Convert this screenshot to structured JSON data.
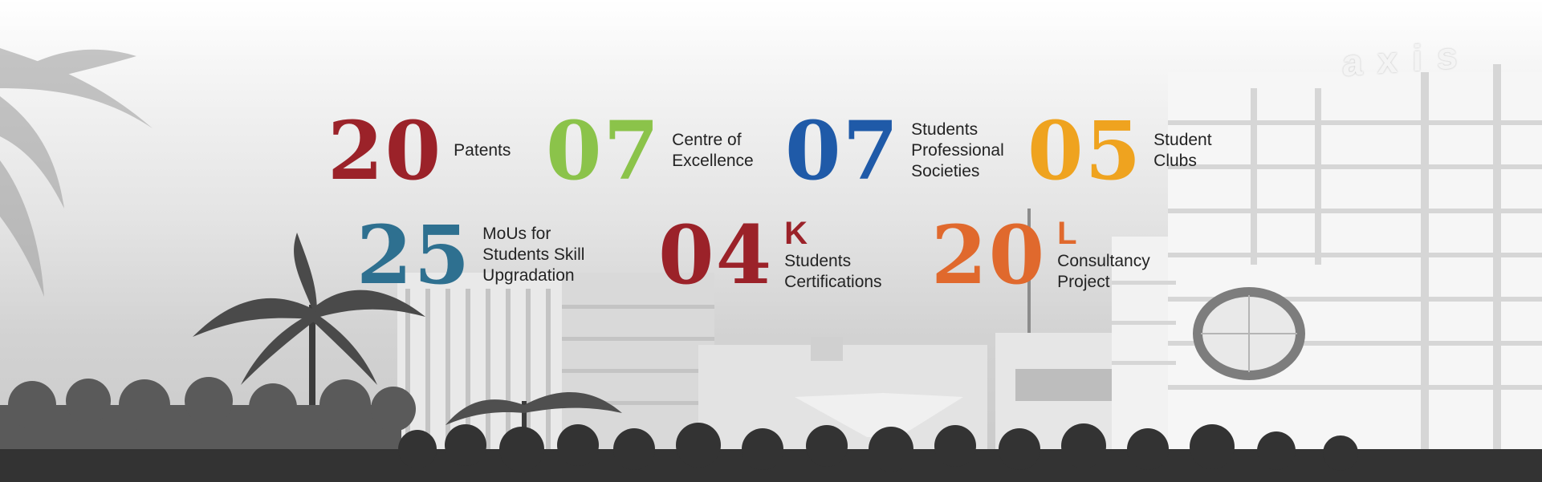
{
  "colors": {
    "red": "#9b2229",
    "green": "#8bc34a",
    "blue": "#1f5aa8",
    "orange": "#efa31f",
    "teal": "#2e7090",
    "dark_orange": "#e0692d"
  },
  "background": {
    "logo_text": "axis"
  },
  "stats": [
    {
      "number": "20",
      "suffix": "",
      "label": "Patents"
    },
    {
      "number": "07",
      "suffix": "",
      "label": "Centre of\nExcellence"
    },
    {
      "number": "07",
      "suffix": "",
      "label": "Students\nProfessional\nSocieties"
    },
    {
      "number": "05",
      "suffix": "",
      "label": "Student\nClubs"
    },
    {
      "number": "25",
      "suffix": "",
      "label": "MoUs for\nStudents Skill\nUpgradation"
    },
    {
      "number": "04",
      "suffix": "K",
      "label": "Students\nCertifications"
    },
    {
      "number": "20",
      "suffix": "L",
      "label": "Consultancy\nProject"
    }
  ]
}
